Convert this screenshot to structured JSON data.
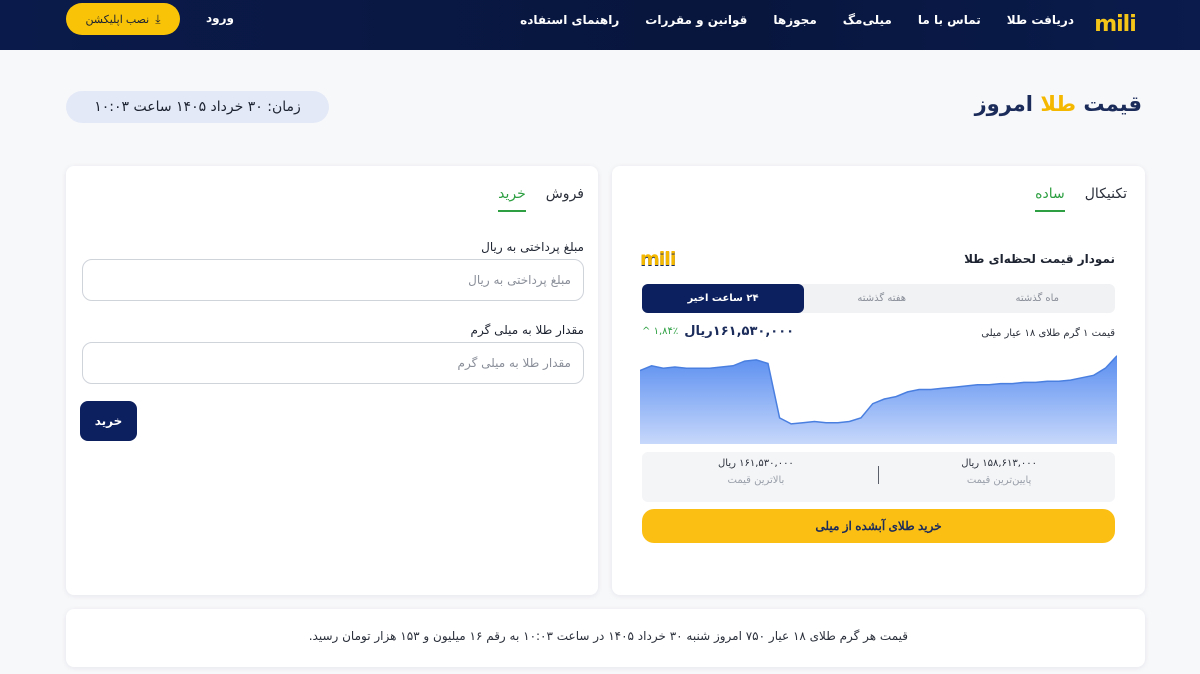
{
  "header": {
    "logo_text": "mili",
    "nav": [
      {
        "label": "راهنمای استفاده"
      },
      {
        "label": "قوانین و مقررات"
      },
      {
        "label": "مجوزها"
      },
      {
        "label": "میلی‌مگ"
      },
      {
        "label": "تماس با ما"
      },
      {
        "label": "دریافت طلا"
      }
    ],
    "login_label": "ورود",
    "install_label": "نصب اپلیکشن"
  },
  "title": {
    "prefix": "قیمت",
    "accent": "طلا",
    "suffix": "امروز"
  },
  "time_text": "زمان: ۳۰ خرداد ۱۴۰۵ ساعت ۱۰:۰۳",
  "chart_card": {
    "tabs": [
      {
        "label": "ساده",
        "active": true
      },
      {
        "label": "تکنیکال",
        "active": false
      }
    ],
    "heading": "نمودار قیمت لحظه‌ای طلا",
    "logo_text": "mili",
    "ranges": [
      {
        "label": "۲۴ ساعت اخیر",
        "active": true
      },
      {
        "label": "هفته گذشته",
        "active": false
      },
      {
        "label": "ماه گذشته",
        "active": false
      }
    ],
    "unit_label": "قیمت ۱ گرم طلای ۱۸ عیار میلی",
    "current_price": "۱۶۱,۵۳۰,۰۰۰ریال",
    "change": "۱,۸۴٪",
    "low": {
      "value": "۱۵۸,۶۱۳,۰۰۰ ریال",
      "label": "پایین‌ترین قیمت"
    },
    "high": {
      "value": "۱۶۱,۵۳۰,۰۰۰ ریال",
      "label": "بالاترین قیمت"
    },
    "buy_label": "خرید طلای آبشده از میلی",
    "colors": {
      "line": "#4a7fe0",
      "fill_top": "#5a8ef0",
      "fill_bottom": "#c7d8fb"
    }
  },
  "chart_data": {
    "type": "area",
    "title": "",
    "xlabel": "",
    "ylabel": "",
    "values": [
      160.9,
      161.1,
      161.0,
      161.05,
      161.0,
      161.0,
      161.0,
      161.05,
      161.1,
      161.3,
      161.35,
      161.2,
      158.9,
      158.65,
      158.7,
      158.75,
      158.7,
      158.7,
      158.75,
      158.9,
      159.5,
      159.7,
      159.8,
      160.0,
      160.1,
      160.1,
      160.15,
      160.2,
      160.25,
      160.3,
      160.3,
      160.35,
      160.35,
      160.4,
      160.4,
      160.45,
      160.45,
      160.5,
      160.6,
      160.7,
      161.0,
      161.53
    ],
    "ylim": [
      157.8,
      161.6
    ]
  },
  "form_card": {
    "tabs": [
      {
        "label": "خرید",
        "active": true
      },
      {
        "label": "فروش",
        "active": false
      }
    ],
    "amount_label": "مبلغ پرداختی به ریال",
    "amount_placeholder": "مبلغ پرداختی به ریال",
    "gold_label": "مقدار طلا به میلی گرم",
    "gold_placeholder": "مقدار طلا به میلی گرم",
    "submit_label": "خرید"
  },
  "footer_text": "قیمت هر گرم طلای ۱۸ عیار ۷۵۰ امروز شنبه ۳۰ خرداد ۱۴۰۵ در ساعت ۱۰:۰۳ به رقم ۱۶ میلیون و ۱۵۳ هزار تومان رسید."
}
